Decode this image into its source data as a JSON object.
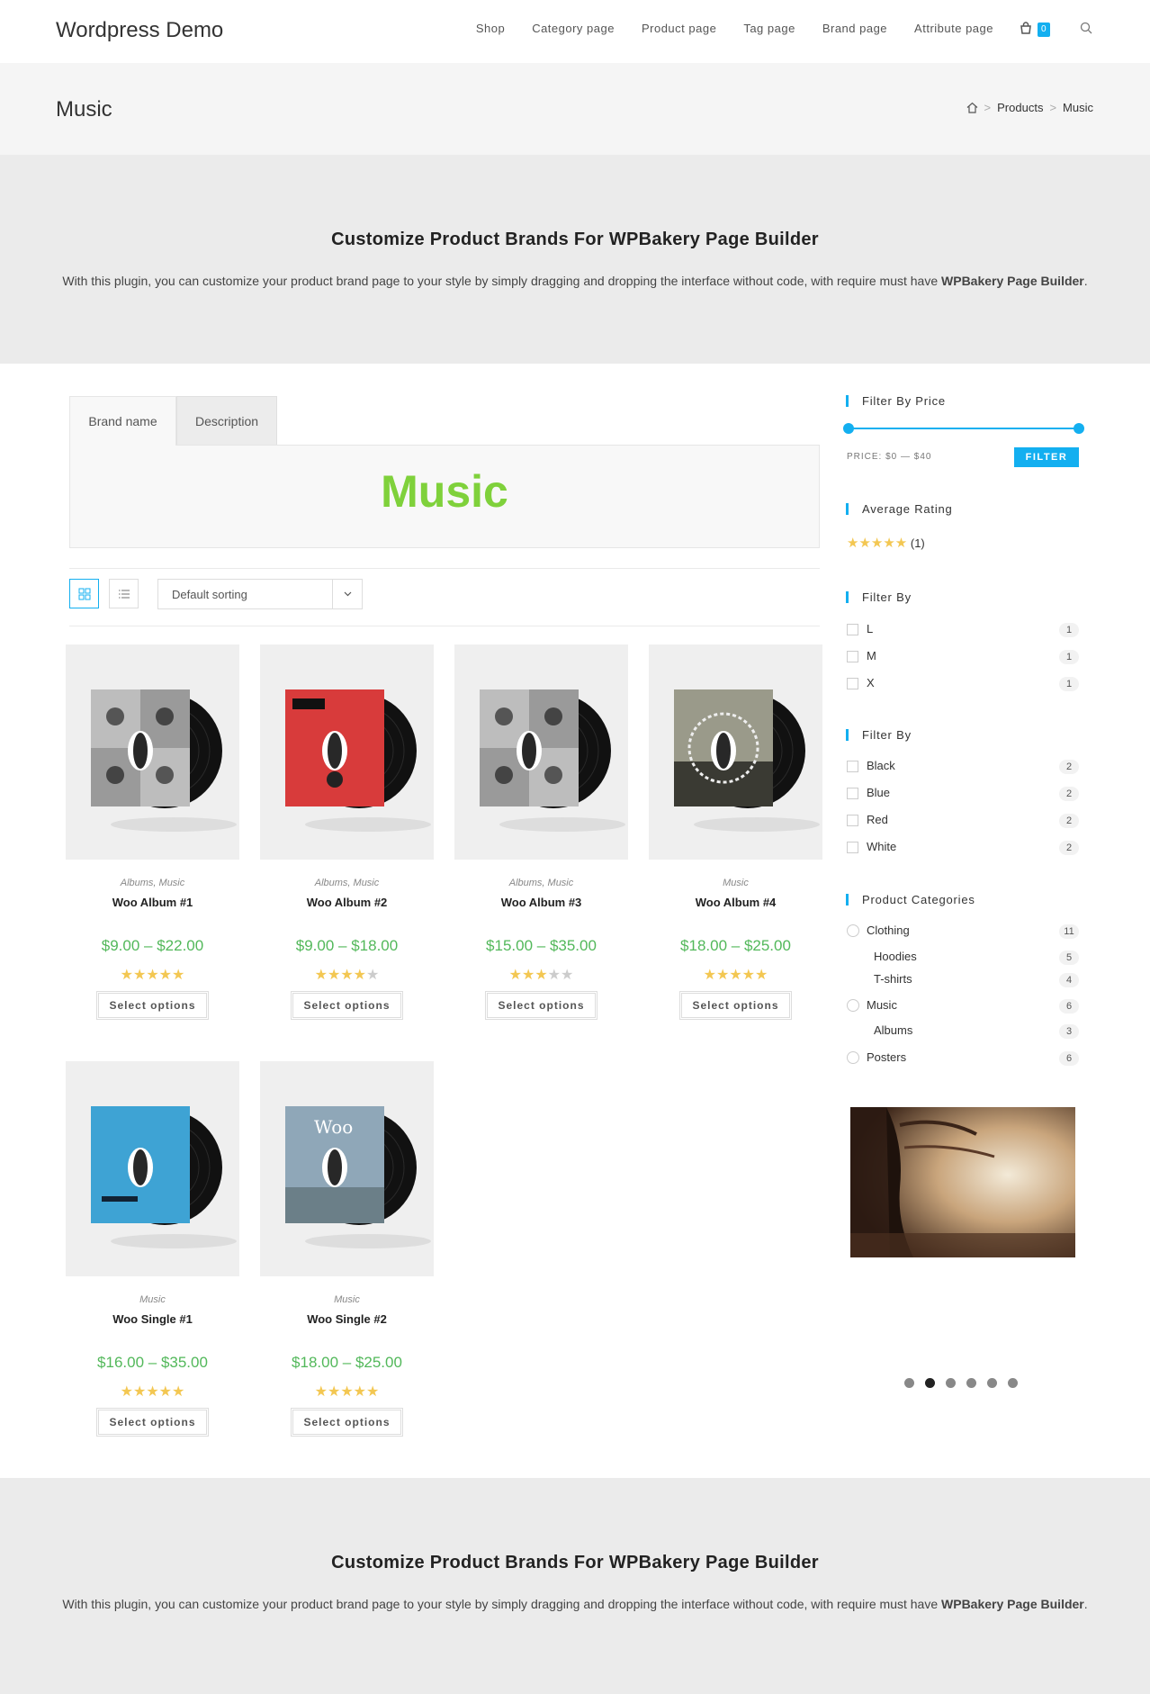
{
  "header": {
    "logo": "Wordpress Demo",
    "nav": [
      "Shop",
      "Category page",
      "Product page",
      "Tag page",
      "Brand page",
      "Attribute page"
    ],
    "cart_count": "0"
  },
  "titlebar": {
    "title": "Music",
    "breadcrumb": [
      "Products",
      "Music"
    ]
  },
  "banner": {
    "heading": "Customize Product Brands For WPBakery Page Builder",
    "text_before": "With this plugin, you can customize your product brand page to your style by simply dragging and dropping the interface without code, with require must have ",
    "text_bold": "WPBakery Page Builder",
    "text_after": "."
  },
  "tabs": {
    "tab1": "Brand name",
    "tab2": "Description",
    "brand_title": "Music"
  },
  "toolbar": {
    "sorting": "Default sorting"
  },
  "products": [
    {
      "cats": "Albums, Music",
      "name": "Woo Album #1",
      "price": "$9.00 – $22.00",
      "rating": 5,
      "button": "Select options",
      "cover": "ninja"
    },
    {
      "cats": "Albums, Music",
      "name": "Woo Album #2",
      "price": "$9.00 – $18.00",
      "rating": 4,
      "button": "Select options",
      "cover": "red"
    },
    {
      "cats": "Albums, Music",
      "name": "Woo Album #3",
      "price": "$15.00 – $35.00",
      "rating": 3,
      "button": "Select options",
      "cover": "ninja"
    },
    {
      "cats": "Music",
      "name": "Woo Album #4",
      "price": "$18.00 – $25.00",
      "rating": 5,
      "button": "Select options",
      "cover": "photo"
    },
    {
      "cats": "Music",
      "name": "Woo Single #1",
      "price": "$16.00 – $35.00",
      "rating": 5,
      "button": "Select options",
      "cover": "blue"
    },
    {
      "cats": "Music",
      "name": "Woo Single #2",
      "price": "$18.00 – $25.00",
      "rating": 4.5,
      "button": "Select options",
      "cover": "sky"
    }
  ],
  "sidebar": {
    "price_title": "Filter By Price",
    "price_label": "PRICE: $0 — $40",
    "filter_button": "FILTER",
    "rating_title": "Average Rating",
    "rating_count": "(1)",
    "size_title": "Filter By",
    "sizes": [
      {
        "label": "L",
        "count": "1"
      },
      {
        "label": "M",
        "count": "1"
      },
      {
        "label": "X",
        "count": "1"
      }
    ],
    "color_title": "Filter By",
    "colors": [
      {
        "label": "Black",
        "count": "2"
      },
      {
        "label": "Blue",
        "count": "2"
      },
      {
        "label": "Red",
        "count": "2"
      },
      {
        "label": "White",
        "count": "2"
      }
    ],
    "cat_title": "Product Categories",
    "categories": [
      {
        "label": "Clothing",
        "count": "11",
        "sub": false
      },
      {
        "label": "Hoodies",
        "count": "5",
        "sub": true
      },
      {
        "label": "T-shirts",
        "count": "4",
        "sub": true
      },
      {
        "label": "Music",
        "count": "6",
        "sub": false
      },
      {
        "label": "Albums",
        "count": "3",
        "sub": true
      },
      {
        "label": "Posters",
        "count": "6",
        "sub": false
      }
    ],
    "slider_dots": 6,
    "slider_active": 1
  },
  "colors": {
    "accent": "#13aff0",
    "price": "#52b85a",
    "brand_title": "#7fd13b",
    "star": "#f3c752"
  }
}
